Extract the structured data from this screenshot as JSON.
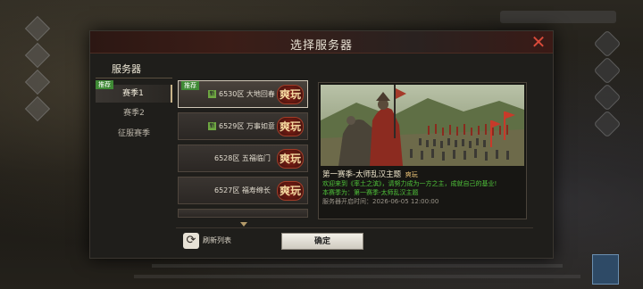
{
  "dialog": {
    "title": "选择服务器",
    "close_label": "✕"
  },
  "categories": {
    "heading": "服务器",
    "items": [
      {
        "label": "赛季1",
        "tag": "推荐",
        "active": true
      },
      {
        "label": "赛季2",
        "tag": "",
        "active": false
      },
      {
        "label": "征服赛季",
        "tag": "",
        "active": false
      }
    ]
  },
  "servers": [
    {
      "name": "6530区 大地回春",
      "hot": "爽玩",
      "tag": "推荐",
      "new": true,
      "selected": true
    },
    {
      "name": "6529区 万事如意",
      "hot": "爽玩",
      "tag": "",
      "new": true,
      "selected": false
    },
    {
      "name": "6528区 五福临门",
      "hot": "爽玩",
      "tag": "",
      "new": false,
      "selected": false
    },
    {
      "name": "6527区 福寿绵长",
      "hot": "爽玩",
      "tag": "",
      "new": false,
      "selected": false
    }
  ],
  "new_icon_text": "新",
  "preview": {
    "title": "第一赛季-太师乱汉主题",
    "title_badge": "爽玩",
    "lines": [
      "欢迎来到《率土之滨》，请努力成为一方之主，成就自己的基业!",
      "本赛季为：第一赛季-太师乱汉主题",
      "服务器开启时间：2026-06-05 12:00:00"
    ]
  },
  "controls": {
    "refresh_label": "刷新列表",
    "refresh_icon": "refresh-icon",
    "confirm_label": "确定"
  },
  "colors": {
    "accent_red": "#d94a3a",
    "recommend_green": "#3f8a35",
    "info_green": "#4fc23a"
  }
}
